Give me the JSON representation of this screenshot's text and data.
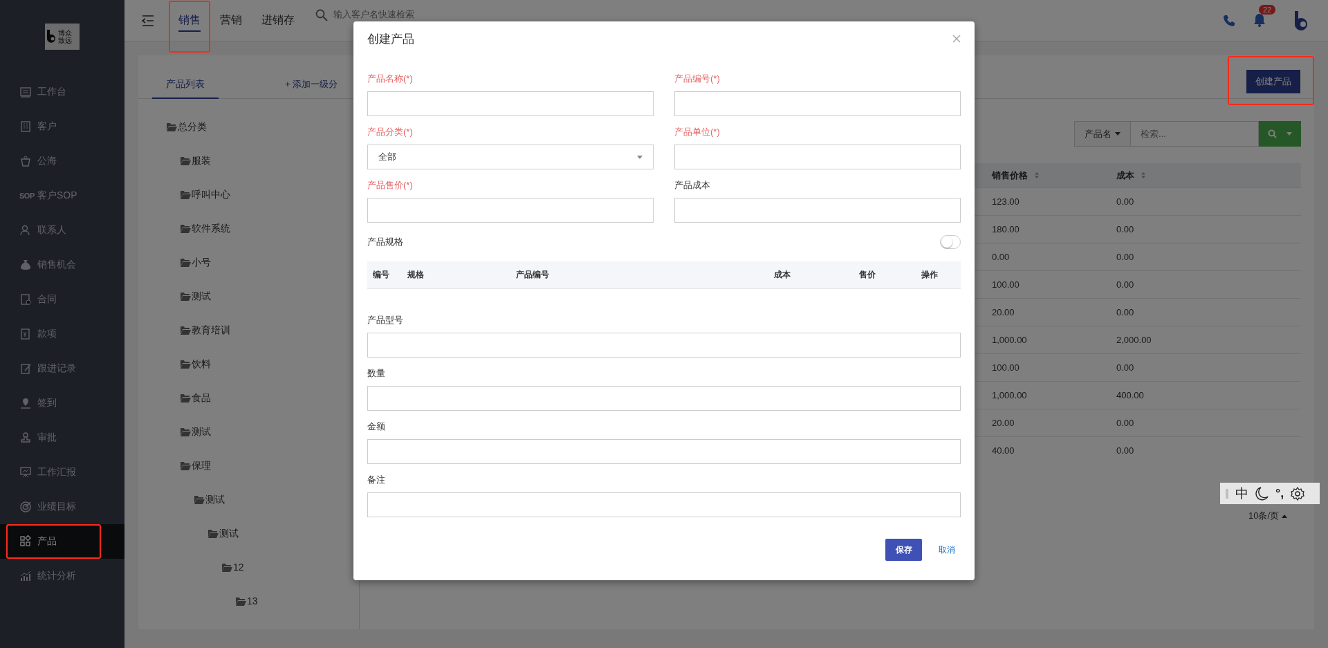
{
  "sidebar": {
    "logo": {
      "line1": "博众",
      "line2": "致远"
    },
    "items": [
      {
        "label": "工作台",
        "selected": false,
        "highlighted": false
      },
      {
        "label": "客户",
        "selected": false,
        "highlighted": false
      },
      {
        "label": "公海",
        "selected": false,
        "highlighted": false
      },
      {
        "label": "客户SOP",
        "icon_text": "SOP",
        "selected": false,
        "highlighted": false
      },
      {
        "label": "联系人",
        "selected": false,
        "highlighted": false
      },
      {
        "label": "销售机会",
        "selected": false,
        "highlighted": false
      },
      {
        "label": "合同",
        "selected": false,
        "highlighted": false
      },
      {
        "label": "款项",
        "selected": false,
        "highlighted": false
      },
      {
        "label": "跟进记录",
        "selected": false,
        "highlighted": false
      },
      {
        "label": "签到",
        "selected": false,
        "highlighted": false
      },
      {
        "label": "审批",
        "selected": false,
        "highlighted": false
      },
      {
        "label": "工作汇报",
        "selected": false,
        "highlighted": false
      },
      {
        "label": "业绩目标",
        "selected": false,
        "highlighted": false
      },
      {
        "label": "产品",
        "selected": true,
        "highlighted": true
      },
      {
        "label": "统计分析",
        "selected": false,
        "highlighted": false
      }
    ]
  },
  "topbar": {
    "tabs": [
      {
        "label": "销售",
        "selected": true,
        "highlighted": true
      },
      {
        "label": "营销",
        "selected": false,
        "highlighted": false
      },
      {
        "label": "进销存",
        "selected": false,
        "highlighted": false
      }
    ],
    "search": {
      "placeholder": "输入客户名快速检索"
    },
    "notification_count": "22"
  },
  "product_panel": {
    "tabs": [
      {
        "label": "产品列表",
        "selected": true
      }
    ],
    "add_link": "+ 添加一级分",
    "create_button": {
      "label": "创建产品",
      "highlighted": true
    },
    "tree": [
      {
        "label": "总分类",
        "children": [
          {
            "label": "服装"
          },
          {
            "label": "呼叫中心"
          },
          {
            "label": "软件系统"
          },
          {
            "label": "小号"
          },
          {
            "label": "测试"
          },
          {
            "label": "教育培训"
          },
          {
            "label": "饮料"
          },
          {
            "label": "食品"
          },
          {
            "label": "测试"
          },
          {
            "label": "保理",
            "children": [
              {
                "label": "测试",
                "children": [
                  {
                    "label": "测试",
                    "children": [
                      {
                        "label": "12",
                        "children": [
                          {
                            "label": "13"
                          }
                        ]
                      }
                    ]
                  }
                ]
              }
            ]
          }
        ]
      }
    ],
    "search": {
      "field_selector": "产品名",
      "placeholder": "检索..."
    },
    "table": {
      "columns": [
        "销售价格",
        "成本"
      ],
      "rows": [
        [
          "123.00",
          "0.00"
        ],
        [
          "180.00",
          "0.00"
        ],
        [
          "0.00",
          "0.00"
        ],
        [
          "100.00",
          "0.00"
        ],
        [
          "20.00",
          "0.00"
        ],
        [
          "1,000.00",
          "2,000.00"
        ],
        [
          "100.00",
          "0.00"
        ],
        [
          "1,000.00",
          "400.00"
        ],
        [
          "20.00",
          "0.00"
        ],
        [
          "40.00",
          "0.00"
        ]
      ]
    },
    "page_size": "10条/页"
  },
  "ime_bar": {
    "mode": "中",
    "punct": "°,"
  },
  "modal": {
    "title": "创建产品",
    "fields": [
      {
        "label": "产品名称(*)",
        "required": true,
        "kind": "text"
      },
      {
        "label": "产品编号(*)",
        "required": true,
        "kind": "text"
      },
      {
        "label": "产品分类(*)",
        "required": true,
        "kind": "select",
        "value": "全部"
      },
      {
        "label": "产品单位(*)",
        "required": true,
        "kind": "text"
      },
      {
        "label": "产品售价(*)",
        "required": true,
        "kind": "text"
      },
      {
        "label": "产品成本",
        "required": false,
        "kind": "text"
      }
    ],
    "spec": {
      "label": "产品规格",
      "on": false,
      "columns": [
        "编号",
        "规格",
        "产品编号",
        "成本",
        "售价",
        "操作"
      ]
    },
    "more_fields": [
      {
        "label": "产品型号",
        "required": false,
        "kind": "text"
      },
      {
        "label": "数量",
        "required": false,
        "kind": "text"
      },
      {
        "label": "金额",
        "required": false,
        "kind": "text"
      },
      {
        "label": "备注",
        "required": false,
        "kind": "text"
      }
    ],
    "save": "保存",
    "cancel": "取消"
  }
}
